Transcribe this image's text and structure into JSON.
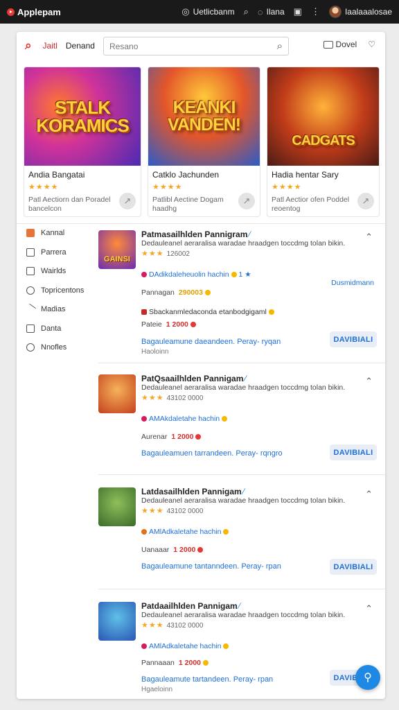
{
  "topbar": {
    "app_name": "Applepam",
    "items": [
      {
        "icon": "target-icon",
        "label": "Uetlicbanm"
      },
      {
        "icon": "search-icon",
        "label": ""
      },
      {
        "icon": "chat-icon",
        "label": "Ilana"
      },
      {
        "icon": "box-icon",
        "label": ""
      },
      {
        "icon": "more-icon",
        "label": ""
      }
    ],
    "user_name": "Iaalaaalosae"
  },
  "header": {
    "link1": "Jaitl",
    "link2": "Denand",
    "search_placeholder": "Resano",
    "right_label1": "Dovel",
    "right_icon2": "heart-icon"
  },
  "featured": [
    {
      "image_text": "STALK KORAMICS",
      "title": "Andia Bangatai",
      "rating": "★★★★",
      "meta": "Patl Aectiorn dan Poradel bancelcon"
    },
    {
      "image_text": "KEANKI VANDEN!",
      "title": "Catklo Jachunden",
      "rating": "★★★★",
      "meta": "Patlibl Aectine Dogam haadhg"
    },
    {
      "image_text": "CADGATS",
      "title": "Hadia hentar Sary",
      "rating": "★★★★",
      "meta": "Patl Aectior ofen Poddel reoentog"
    }
  ],
  "sidebar": [
    {
      "label": "Kannal",
      "icon": "flame-icon"
    },
    {
      "label": "Parrera",
      "icon": "square-icon"
    },
    {
      "label": "Wairlds",
      "icon": "check-icon"
    },
    {
      "label": "Topricentons",
      "icon": "location-icon"
    },
    {
      "label": "Madias",
      "icon": "slash-icon"
    },
    {
      "label": "Danta",
      "icon": "box-icon"
    },
    {
      "label": "Nnofles",
      "icon": "user-icon"
    }
  ],
  "list": [
    {
      "title": "Patmasailhlden Pannigram",
      "desc": "Dedauleanel aeraralisa waradae hraadgen toccdmg tolan bikin.",
      "rating_text": "126002",
      "tags": "DAdikdaleheuolin hachin",
      "tag_suffix": "1 ★",
      "side_link": "Dusmidmann",
      "extra_small": "",
      "extra_line": "Sbackanmledaconda etanbodgigaml",
      "price_label": "Pateie",
      "price": "1 2000",
      "link": "Bagauleamune daeandeen. Peray- ryqan",
      "sub": "Haoloinn",
      "button": "DAVIBIALI",
      "icon_text": "GAINSI",
      "pre_price_label": "Pannagan",
      "pre_price": "290003"
    },
    {
      "title": "PatQsaailhlden Pannigam",
      "desc": "Dedauleanel aeraralisa waradae hraadgen toccdmg tolan bikin.",
      "rating_text": "43102 0000",
      "tags": "AMAkdaletahe hachin",
      "price_label": "Aurenar",
      "price": "1 2000",
      "link": "Bagauleamuen tarrandeen. Peray- rqngro",
      "button": "DAVIBIALI"
    },
    {
      "title": "Latdasailhlden Pannigam",
      "desc": "Dedauleanel aeraralisa waradae hraadgen toccdmg tolan bikin.",
      "rating_text": "43102 0000",
      "tags": "AMlAdkaletahe hachin",
      "price_label": "Uanaaar",
      "price": "1 2000",
      "link": "Bagauleamune tantanndeen. Peray- rpan",
      "button": "DAVIBIALI"
    },
    {
      "title": "Patdaailhlden Pannigam",
      "desc": "Dedauleanel aeraralisa waradae hraadgen toccdmg tolan bikin.",
      "rating_text": "43102 0000",
      "tags": "AMlAdkaletahe hachin",
      "price_label": "Pannaaan",
      "price": "1 2000",
      "link": "Bagauleamute tartandeen. Peray- rpan",
      "sub": "Hgaeloinn",
      "button": "DAVIBIALI"
    }
  ]
}
